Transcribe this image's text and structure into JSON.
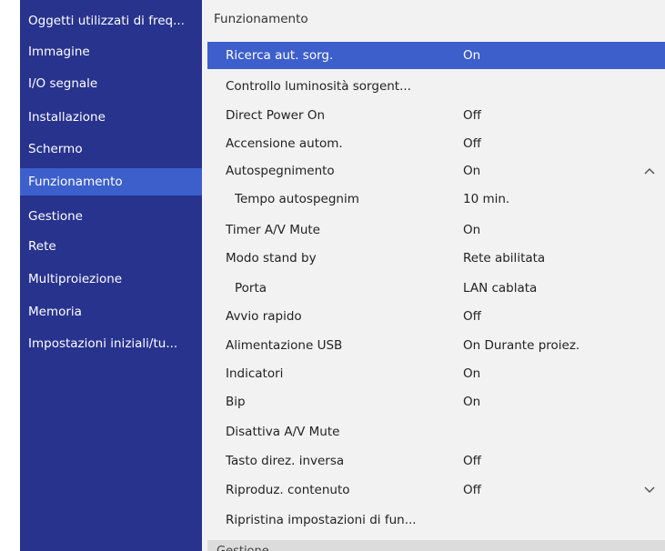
{
  "colors": {
    "sidebar_bg": "#28338e",
    "accent": "#3d5fcb",
    "panel_bg": "#f2f2f2"
  },
  "sidebar": {
    "items": [
      {
        "label": "Oggetti utilizzati di freq..."
      },
      {
        "label": "Immagine"
      },
      {
        "label": "I/O segnale"
      },
      {
        "label": "Installazione"
      },
      {
        "label": "Schermo"
      },
      {
        "label": "Funzionamento",
        "active": true
      },
      {
        "label": "Gestione"
      },
      {
        "label": "Rete"
      },
      {
        "label": "Multiproiezione"
      },
      {
        "label": "Memoria"
      },
      {
        "label": "Impostazioni iniziali/tu..."
      }
    ]
  },
  "panel": {
    "title": "Funzionamento",
    "rows": [
      {
        "label": "Ricerca aut. sorg.",
        "value": "On",
        "selected": true
      },
      {
        "label": "Controllo luminosità sorgent...",
        "value": ""
      },
      {
        "label": "Direct Power On",
        "value": "Off"
      },
      {
        "label": "Accensione autom.",
        "value": "Off"
      },
      {
        "label": "Autospegnimento",
        "value": "On",
        "icon": "chevron-up-icon"
      },
      {
        "label": "Tempo autospegnim",
        "value": "10 min.",
        "sub": true
      },
      {
        "label": "Timer A/V Mute",
        "value": "On"
      },
      {
        "label": "Modo stand by",
        "value": "Rete abilitata"
      },
      {
        "label": "Porta",
        "value": "LAN cablata",
        "sub": true
      },
      {
        "label": "Avvio rapido",
        "value": "Off"
      },
      {
        "label": "Alimentazione USB",
        "value": "On Durante proiez."
      },
      {
        "label": "Indicatori",
        "value": "On"
      },
      {
        "label": "Bip",
        "value": "On"
      },
      {
        "label": "Disattiva A/V Mute",
        "value": ""
      },
      {
        "label": "Tasto direz. inversa",
        "value": "Off"
      },
      {
        "label": "Riproduz. contenuto",
        "value": "Off",
        "icon": "chevron-down-icon"
      },
      {
        "label": "Ripristina impostazioni di fun...",
        "value": ""
      }
    ],
    "next_section": "Gestione"
  }
}
